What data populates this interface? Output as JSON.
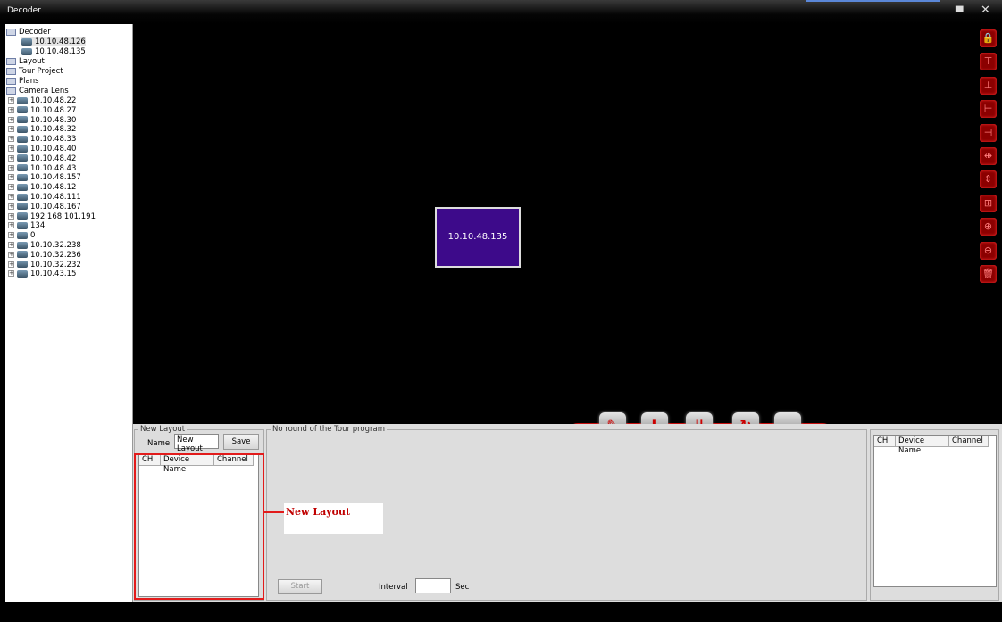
{
  "window": {
    "title": "Decoder"
  },
  "tree": {
    "roots": [
      {
        "label": "Decoder",
        "children": [
          "10.10.48.126",
          "10.10.48.135"
        ]
      },
      {
        "label": "Layout"
      },
      {
        "label": "Tour Project"
      },
      {
        "label": "Plans"
      },
      {
        "label": "Camera Lens",
        "children": [
          "10.10.48.22",
          "10.10.48.27",
          "10.10.48.30",
          "10.10.48.32",
          "10.10.48.33",
          "10.10.48.40",
          "10.10.48.42",
          "10.10.48.43",
          "10.10.48.157",
          "10.10.48.12",
          "10.10.48.111",
          "10.10.48.167",
          "192.168.101.191",
          "134",
          "0",
          "10.10.32.238",
          "10.10.32.236",
          "10.10.32.232",
          "10.10.43.15"
        ]
      }
    ],
    "selected": "10.10.48.126"
  },
  "canvas": {
    "tile_label": "10.10.48.135"
  },
  "right_toolbar": [
    "lock-icon",
    "align-top-icon",
    "align-bottom-icon",
    "align-left-icon",
    "align-right-icon",
    "equal-width-icon",
    "equal-height-icon",
    "grid-icon",
    "zoom-in-icon",
    "zoom-out-icon",
    "delete-icon"
  ],
  "bottom_toolbar": [
    "edit-icon",
    "download-icon",
    "download-all-icon",
    "refresh-icon",
    "eraser-icon"
  ],
  "new_layout": {
    "group_label": "New Layout",
    "name_label": "Name",
    "name_value": "New Layout",
    "save_label": "Save",
    "columns": [
      "CH",
      "Device Name",
      "Channel"
    ]
  },
  "tour": {
    "group_label": "No round of the Tour program",
    "start_label": "Start",
    "interval_label": "Interval",
    "interval_value": "",
    "sec_label": "Sec"
  },
  "right_list": {
    "columns": [
      "CH",
      "Device Name",
      "Channel"
    ]
  },
  "annotation": {
    "text": "New Layout",
    "color": "#c00000"
  },
  "colors": {
    "tile": "#3d0a8a",
    "accent_red": "#e21b1b"
  }
}
